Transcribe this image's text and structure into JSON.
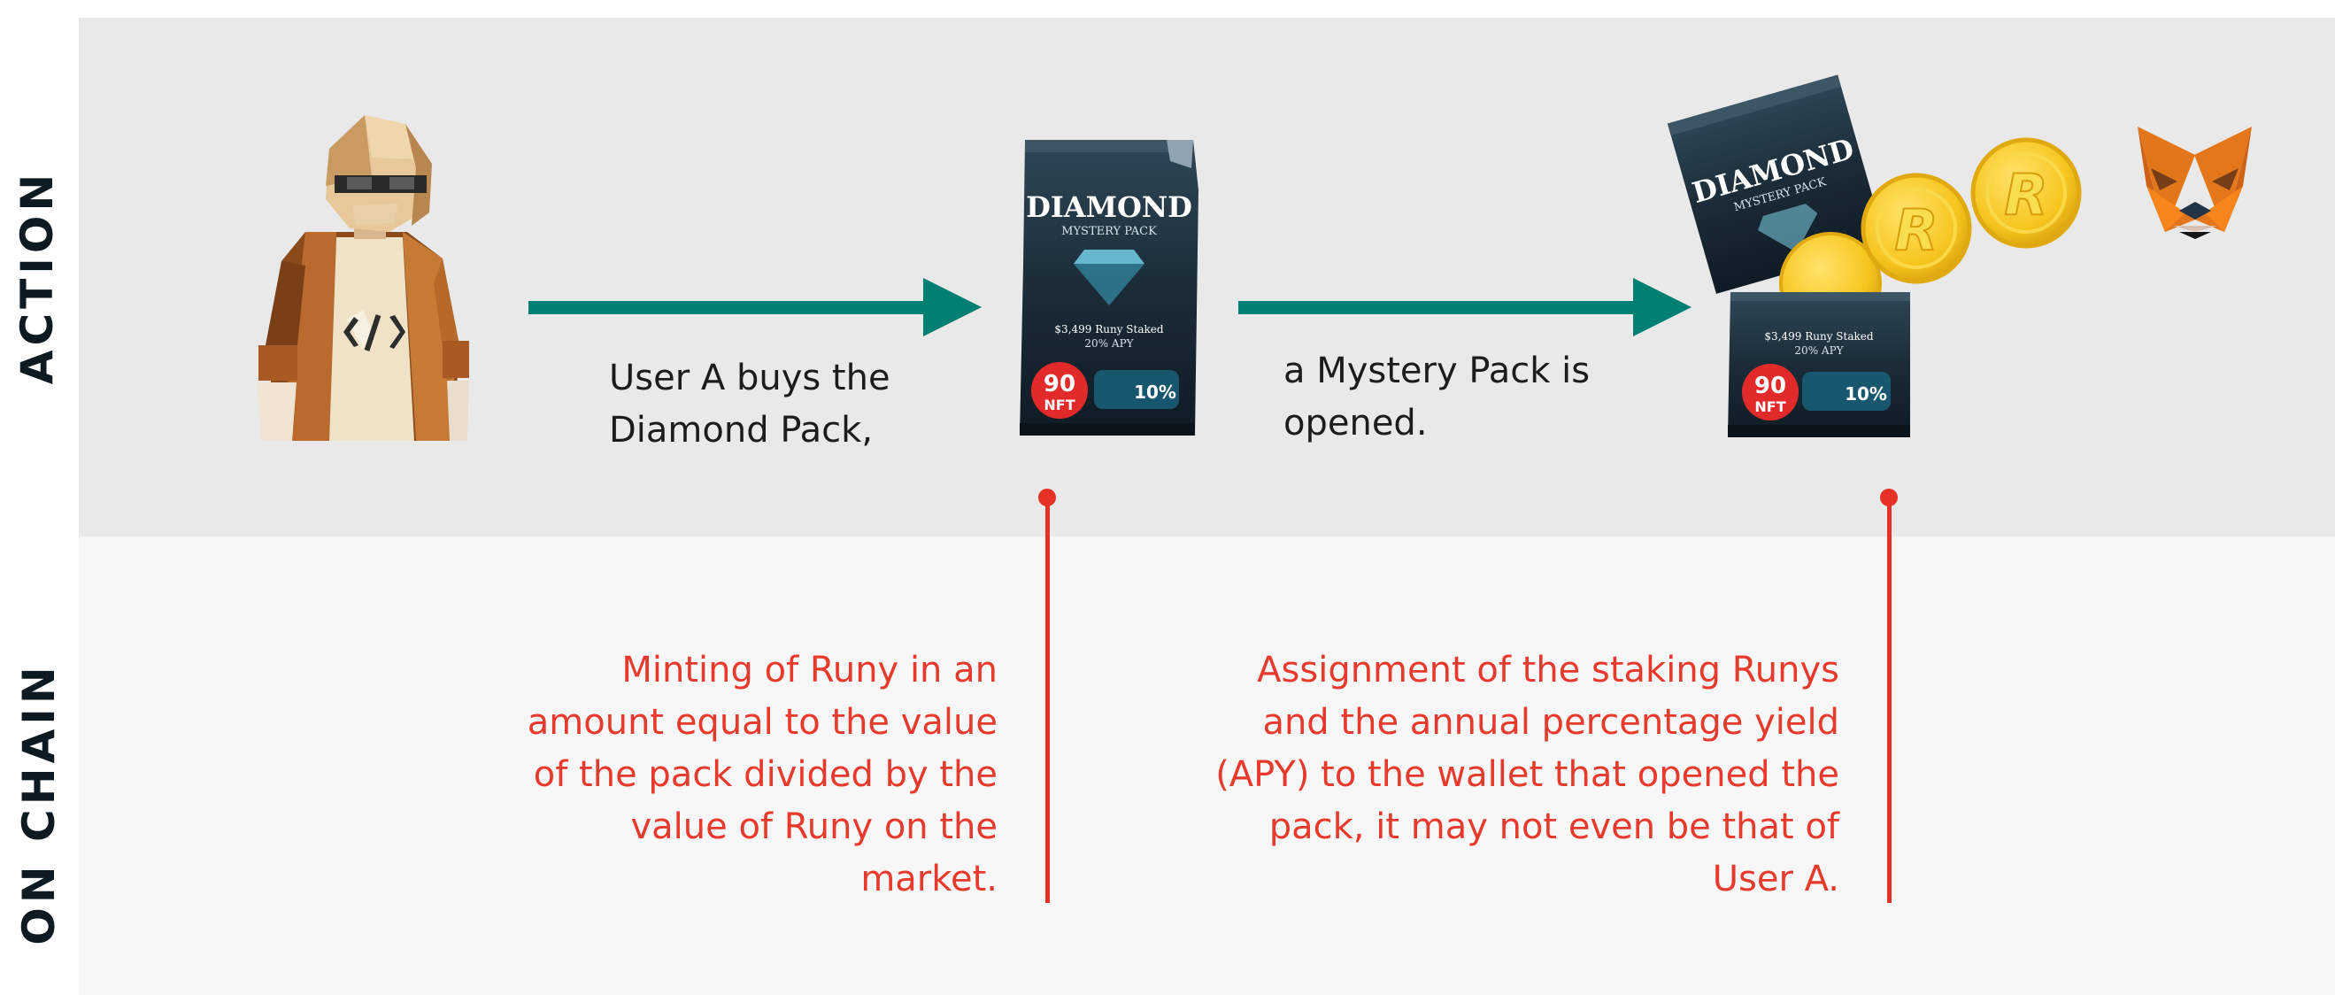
{
  "rows": {
    "action_label": "ACTION",
    "onchain_label": "ON CHAIN"
  },
  "actions": {
    "buy_caption": "User A buys the\nDiamond Pack,",
    "open_caption": "a Mystery Pack is\nopened."
  },
  "onchain": {
    "minting_text": "Minting of Runy in an\namount equal to the value\nof the pack divided by the\nvalue of Runy on the\nmarket.",
    "assignment_text": "Assignment of the staking Runys\nand the annual percentage yield\n(APY) to the wallet that opened the\npack, it may not even be that of\nUser A."
  },
  "pack": {
    "title": "DIAMOND",
    "subtitle": "MYSTERY PACK",
    "staked": "$3,499 Runy Staked",
    "apy": "20% APY",
    "badge_number": "90",
    "badge_label": "NFT",
    "chance": "10%"
  },
  "coin": {
    "letter": "R"
  },
  "colors": {
    "arrow": "#007f72",
    "connector": "#e63127",
    "band_action": "#e9e9e9",
    "band_onchain": "#f7f7f7"
  },
  "icons": [
    "user-avatar-icon",
    "diamond-pack-icon",
    "opened-pack-icon",
    "runy-coin-icon",
    "metamask-fox-icon"
  ]
}
